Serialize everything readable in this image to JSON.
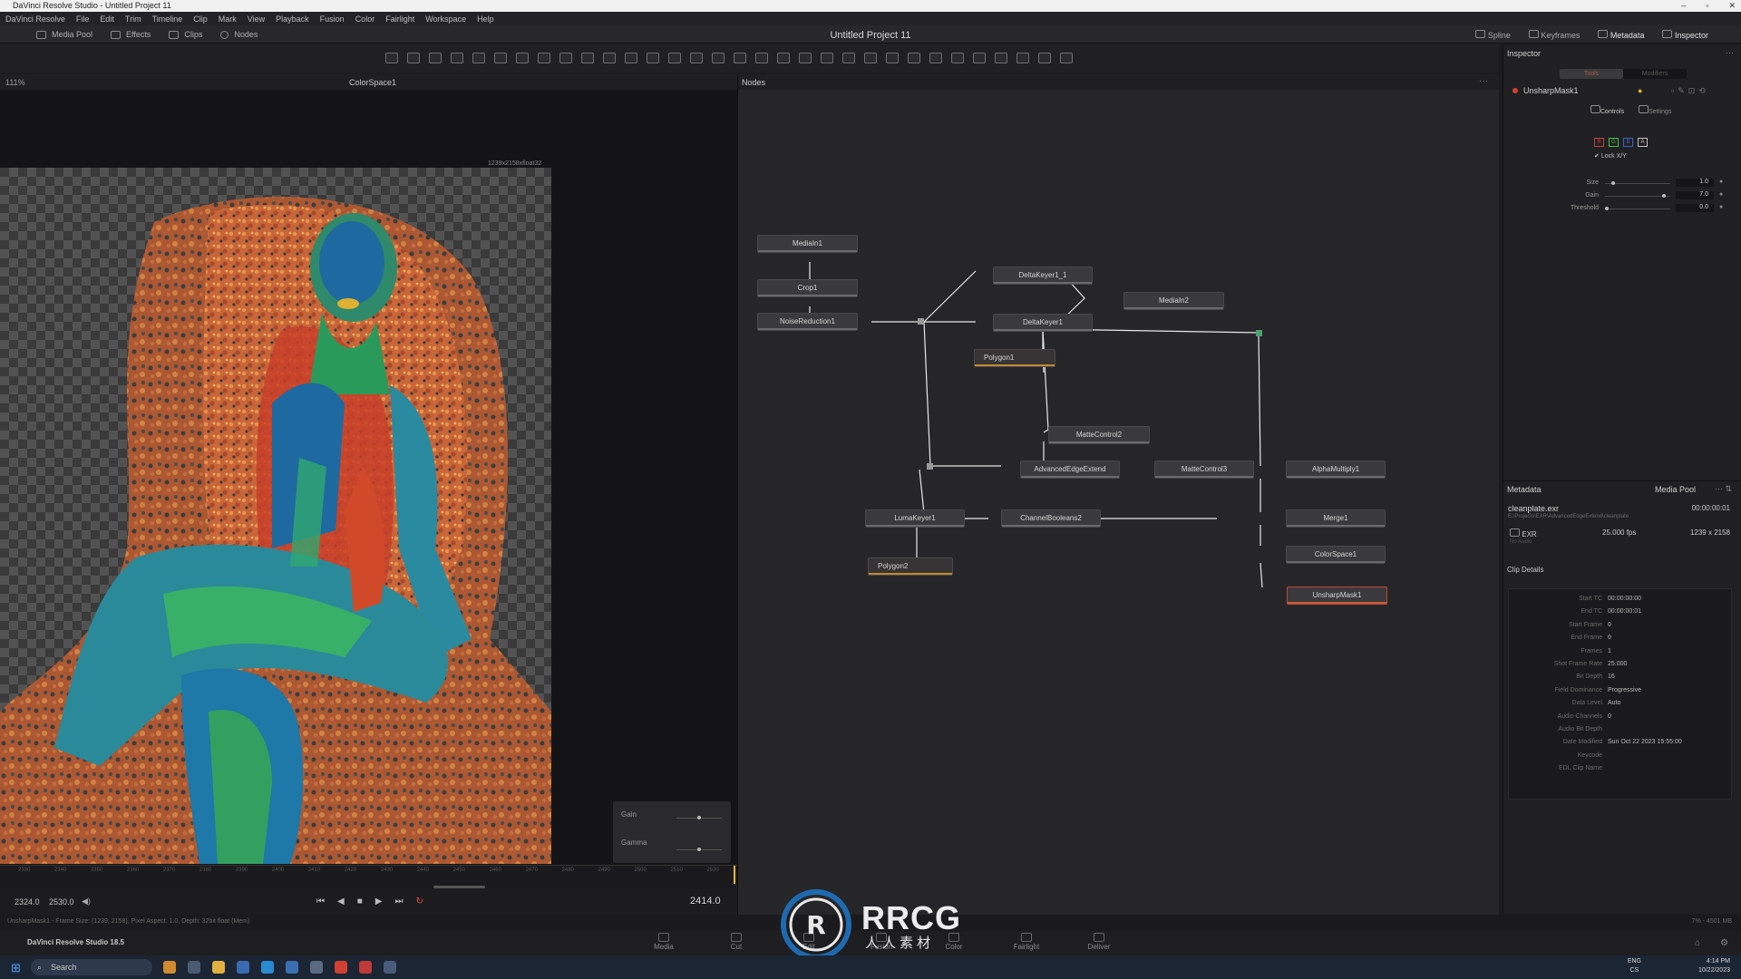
{
  "window": {
    "title": "DaVinci Resolve Studio - Untitled Project 11"
  },
  "menu": [
    "DaVinci Resolve",
    "File",
    "Edit",
    "Trim",
    "Timeline",
    "Clip",
    "Mark",
    "View",
    "Playback",
    "Fusion",
    "Color",
    "Fairlight",
    "Workspace",
    "Help"
  ],
  "header": {
    "media_pool": "Media Pool",
    "effects": "Effects",
    "clips": "Clips",
    "nodes": "Nodes",
    "project_title": "Untitled Project 11",
    "spline": "Spline",
    "keyframes": "Keyframes",
    "metadata": "Metadata",
    "inspector": "Inspector"
  },
  "viewer": {
    "zoom": "111%",
    "title": "ColorSpace1",
    "resolution": "1239x2158xfloat32",
    "gain_label": "Gain",
    "gamma_label": "Gamma",
    "tc_in": "2324.0",
    "tc_out": "2530.0",
    "tc_current": "2414.0",
    "ticks": [
      "2330",
      "2340",
      "2350",
      "2360",
      "2370",
      "2380",
      "2390",
      "2400",
      "2410",
      "2420",
      "2430",
      "2440",
      "2450",
      "2460",
      "2470",
      "2480",
      "2490",
      "2500",
      "2510",
      "2520"
    ],
    "gain_value_fraction": 0.5,
    "gamma_value_fraction": 0.5,
    "playhead_fraction": 0.998
  },
  "nodes_panel": {
    "title": "Nodes",
    "nodes": [
      "MediaIn1",
      "Crop1",
      "NoiseReduction1",
      "DeltaKeyer1_1",
      "DeltaKeyer1",
      "MediaIn2",
      "Polygon1",
      "MatteControl2",
      "AdvancedEdgeExtend",
      "MatteControl3",
      "AlphaMultiply1",
      "LumaKeyer1",
      "ChannelBooleans2",
      "Merge1",
      "ColorSpace1",
      "Polygon2",
      "UnsharpMask1"
    ],
    "selected": "UnsharpMask1"
  },
  "inspector": {
    "title": "Inspector",
    "tab_tools": "Tools",
    "tab_modifiers": "Modifiers",
    "tool_name": "UnsharpMask1",
    "controls": "Controls",
    "settings": "Settings",
    "channels": [
      "R",
      "G",
      "B",
      "A"
    ],
    "lock_xy": "Lock X/Y",
    "params": [
      {
        "label": "Size",
        "value": "1.0",
        "fraction": 0.1
      },
      {
        "label": "Gain",
        "value": "7.0",
        "fraction": 0.92
      },
      {
        "label": "Threshold",
        "value": "0.0",
        "fraction": 0.0
      }
    ]
  },
  "metadata": {
    "title": "Metadata",
    "media_pool": "Media Pool",
    "filename": "cleanplate.exr",
    "path": "E:\\Projects\\EXR\\AdvancedEdgeExtend\\cleanplate",
    "duration": "00:00:00:01",
    "format": "EXR",
    "fps": "25.000 fps",
    "dimensions": "1239 x 2158",
    "audio": "No Audio",
    "clip_details": "Clip Details",
    "rows": [
      {
        "k": "Start TC",
        "v": "00:00:00:00"
      },
      {
        "k": "End TC",
        "v": "00:00:00:01"
      },
      {
        "k": "Start Frame",
        "v": "0"
      },
      {
        "k": "End Frame",
        "v": "0"
      },
      {
        "k": "Frames",
        "v": "1"
      },
      {
        "k": "Shot Frame Rate",
        "v": "25.000"
      },
      {
        "k": "Bit Depth",
        "v": "16"
      },
      {
        "k": "Field Dominance",
        "v": "Progressive"
      },
      {
        "k": "Data Level",
        "v": "Auto"
      },
      {
        "k": "Audio Channels",
        "v": "0"
      },
      {
        "k": "Audio Bit Depth",
        "v": ""
      },
      {
        "k": "Date Modified",
        "v": "Sun Oct 22 2023 15:55:00"
      },
      {
        "k": "Keycode",
        "v": ""
      },
      {
        "k": "EDL Clip Name",
        "v": ""
      }
    ]
  },
  "status": {
    "left": "UnsharpMask1 - Frame Size: (1239, 2158), Pixel Aspect: 1.0, Depth: 32bit float (Mem)",
    "right": "7% - 4501 MB"
  },
  "pagebar": {
    "app_name": "DaVinci Resolve Studio 18.5",
    "pages": [
      "Media",
      "Cut",
      "Edit",
      "Fusion",
      "Color",
      "Fairlight",
      "Deliver"
    ]
  },
  "watermark": {
    "text": "RRCG",
    "sub": "人人素材"
  },
  "taskbar": {
    "search": "Search",
    "lang1": "ENG",
    "lang2": "CS",
    "time": "4:14 PM",
    "date": "10/22/2023"
  }
}
